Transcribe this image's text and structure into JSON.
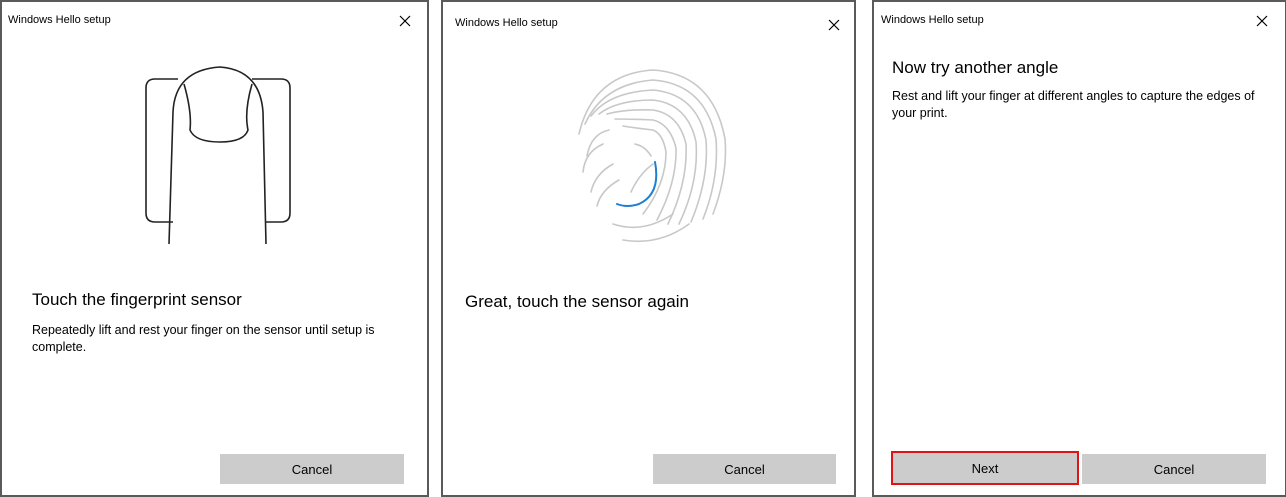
{
  "dialogs": [
    {
      "title": "Windows Hello setup",
      "heading": "Touch the fingerprint sensor",
      "description": "Repeatedly lift and rest your finger on the sensor until setup is complete.",
      "buttons": {
        "cancel": "Cancel"
      }
    },
    {
      "title": "Windows Hello setup",
      "heading": "Great, touch the sensor again",
      "buttons": {
        "cancel": "Cancel"
      }
    },
    {
      "title": "Windows Hello setup",
      "heading": "Now try another angle",
      "description": "Rest and lift your finger at different angles to capture the edges of your print.",
      "buttons": {
        "next": "Next",
        "cancel": "Cancel"
      }
    }
  ],
  "icons": {
    "close": "close-icon",
    "finger": "finger-on-sensor-icon",
    "fingerprint": "fingerprint-icon"
  },
  "colors": {
    "button_bg": "#cccccc",
    "accent_blue": "#1f7fd1",
    "highlight_red": "#e01414",
    "illustration_gray": "#c8c8c8"
  }
}
